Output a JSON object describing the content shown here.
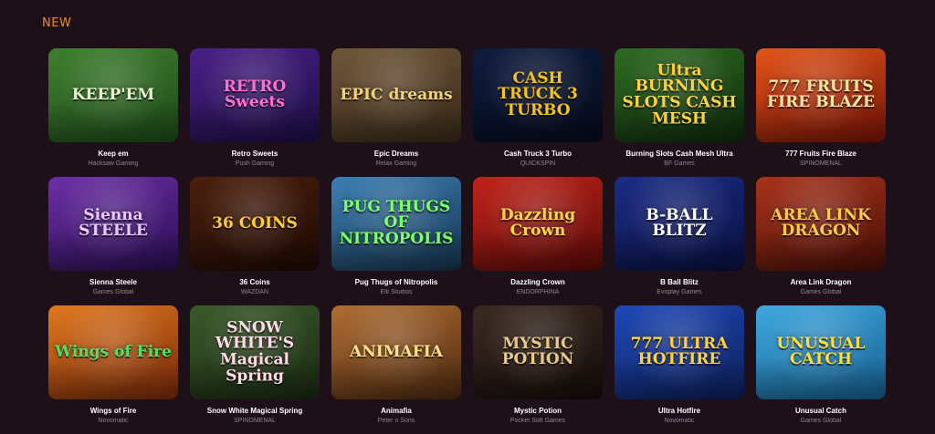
{
  "section": {
    "title": "NEW"
  },
  "games": [
    {
      "name": "Keep em",
      "provider": "Hacksaw Gaming",
      "logo": "KEEP'EM",
      "bg": "#3f7f2e",
      "bg2": "#1f4a1a",
      "logo_color": "#e9f5d0"
    },
    {
      "name": "Retro Sweets",
      "provider": "Push Gaming",
      "logo": "RETRO Sweets",
      "bg": "#4a1f86",
      "bg2": "#1c0f45",
      "logo_color": "#ff6fd0"
    },
    {
      "name": "Epic Dreams",
      "provider": "Relax Gaming",
      "logo": "EPIC dreams",
      "bg": "#6e5638",
      "bg2": "#3a2a1a",
      "logo_color": "#f3d277"
    },
    {
      "name": "Cash Truck 3 Turbo",
      "provider": "QUICKSPIN",
      "logo": "CASH TRUCK 3 TURBO",
      "bg": "#0f1c3d",
      "bg2": "#060b1c",
      "logo_color": "#f6c21c"
    },
    {
      "name": "Burning Slots Cash Mesh Ultra",
      "provider": "BF Games",
      "logo": "Ultra BURNING SLOTS CASH MESH",
      "bg": "#2e6b22",
      "bg2": "#0f2a0c",
      "logo_color": "#ffd23a"
    },
    {
      "name": "777 Fruits Fire Blaze",
      "provider": "SPINOMENAL",
      "logo": "777 FRUITS FIRE BLAZE",
      "bg": "#e2541a",
      "bg2": "#7a1406",
      "logo_color": "#ffe7a3"
    },
    {
      "name": "Sienna Steele",
      "provider": "Games Global",
      "logo": "Sienna STEELE",
      "bg": "#6b2fa6",
      "bg2": "#2a0f52",
      "logo_color": "#e8c7ff"
    },
    {
      "name": "36 Coins",
      "provider": "WAZDAN",
      "logo": "36 COINS",
      "bg": "#4a1f0c",
      "bg2": "#1e0a04",
      "logo_color": "#ffcc33"
    },
    {
      "name": "Pug Thugs of Nitropolis",
      "provider": "Elk Studios",
      "logo": "PUG THUGS OF NITROPOLIS",
      "bg": "#3b7fb4",
      "bg2": "#17344d",
      "logo_color": "#7dff6a"
    },
    {
      "name": "Dazzling Crown",
      "provider": "ENDORPHINA",
      "logo": "Dazzling Crown",
      "bg": "#c1241a",
      "bg2": "#5c0a08",
      "logo_color": "#ffd54a"
    },
    {
      "name": "B Ball Blitz",
      "provider": "Evoplay Games",
      "logo": "B-BALL BLITZ",
      "bg": "#1b2c86",
      "bg2": "#0a1040",
      "logo_color": "#ffffff"
    },
    {
      "name": "Area Link Dragon",
      "provider": "Games Global",
      "logo": "AREA LINK DRAGON",
      "bg": "#a8331b",
      "bg2": "#4a0f07",
      "logo_color": "#ffc94a"
    },
    {
      "name": "Wings of Fire",
      "provider": "Novomatic",
      "logo": "Wings of Fire",
      "bg": "#e0781e",
      "bg2": "#7a2a0a",
      "logo_color": "#4fe06a"
    },
    {
      "name": "Snow White Magical Spring",
      "provider": "SPINOMENAL",
      "logo": "SNOW WHITE'S Magical Spring",
      "bg": "#3a5a2a",
      "bg2": "#1a2a12",
      "logo_color": "#ffd9e6"
    },
    {
      "name": "Animafia",
      "provider": "Peter n Sons",
      "logo": "ANIMAFIA",
      "bg": "#b06d32",
      "bg2": "#4d2a10",
      "logo_color": "#ffe08a"
    },
    {
      "name": "Mystic Potion",
      "provider": "Pocket Soft Games",
      "logo": "MYSTIC POTION",
      "bg": "#3a2a22",
      "bg2": "#140d0a",
      "logo_color": "#e9c98a"
    },
    {
      "name": "Ultra Hotfire",
      "provider": "Novomatic",
      "logo": "777 ULTRA HOTFIRE",
      "bg": "#1f49b8",
      "bg2": "#0c1f5a",
      "logo_color": "#ffd23a"
    },
    {
      "name": "Unusual Catch",
      "provider": "Games Global",
      "logo": "UNUSUAL CATCH",
      "bg": "#3fa8e0",
      "bg2": "#166090",
      "logo_color": "#ffde3a"
    }
  ]
}
